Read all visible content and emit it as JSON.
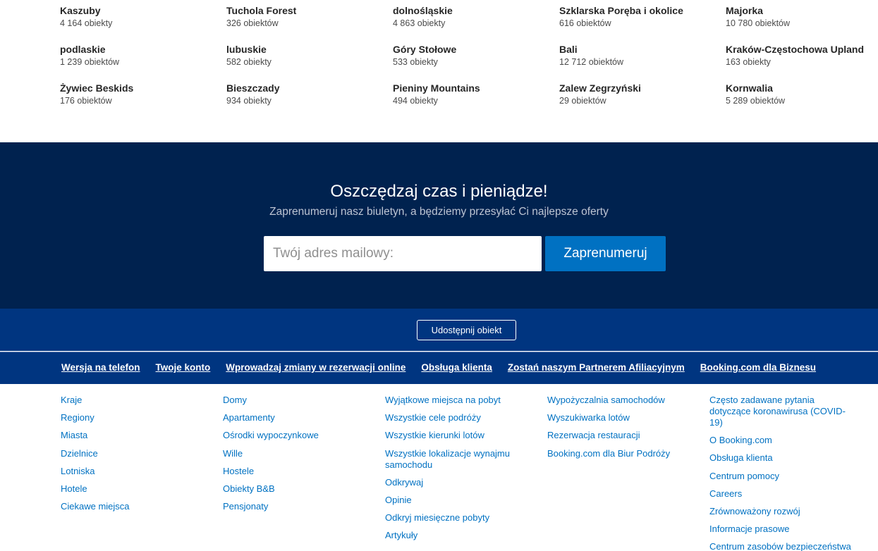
{
  "destinations": [
    {
      "name": "Kaszuby",
      "count": "4 164 obiekty"
    },
    {
      "name": "Tuchola Forest",
      "count": "326 obiektów"
    },
    {
      "name": "dolnośląskie",
      "count": "4 863 obiekty"
    },
    {
      "name": "Szklarska Poręba i okolice",
      "count": "616 obiektów"
    },
    {
      "name": "Majorka",
      "count": "10 780 obiektów"
    },
    {
      "name": "podlaskie",
      "count": "1 239 obiektów"
    },
    {
      "name": "lubuskie",
      "count": "582 obiekty"
    },
    {
      "name": "Góry Stołowe",
      "count": "533 obiekty"
    },
    {
      "name": "Bali",
      "count": "12 712 obiektów"
    },
    {
      "name": "Kraków-Częstochowa Upland",
      "count": "163 obiekty"
    },
    {
      "name": "Żywiec Beskids",
      "count": "176 obiektów"
    },
    {
      "name": "Bieszczady",
      "count": "934 obiekty"
    },
    {
      "name": "Pieniny Mountains",
      "count": "494 obiekty"
    },
    {
      "name": "Zalew Zegrzyński",
      "count": "29 obiektów"
    },
    {
      "name": "Kornwalia",
      "count": "5 289 obiektów"
    }
  ],
  "newsletter": {
    "title": "Oszczędzaj czas i pieniądze!",
    "subtitle": "Zaprenumeruj nasz biuletyn, a będziemy przesyłać Ci najlepsze oferty",
    "email_placeholder": "Twój adres mailowy:",
    "subscribe_label": "Zaprenumeruj"
  },
  "list_property": {
    "button_label": "Udostępnij obiekt"
  },
  "footer_bar": {
    "links": [
      "Wersja na telefon",
      "Twoje konto",
      "Wprowadzaj zmiany w rezerwacji online",
      "Obsługa klienta",
      "Zostań naszym Partnerem Afiliacyjnym",
      "Booking.com dla Biznesu"
    ]
  },
  "footer_columns": [
    [
      "Kraje",
      "Regiony",
      "Miasta",
      "Dzielnice",
      "Lotniska",
      "Hotele",
      "Ciekawe miejsca"
    ],
    [
      "Domy",
      "Apartamenty",
      "Ośrodki wypoczynkowe",
      "Wille",
      "Hostele",
      "Obiekty B&B",
      "Pensjonaty"
    ],
    [
      "Wyjątkowe miejsca na pobyt",
      "Wszystkie cele podróży",
      "Wszystkie kierunki lotów",
      "Wszystkie lokalizacje wynajmu samochodu",
      "Odkrywaj",
      "Opinie",
      "Odkryj miesięczne pobyty",
      "Artykuły"
    ],
    [
      "Wypożyczalnia samochodów",
      "Wyszukiwarka lotów",
      "Rezerwacja restauracji",
      "Booking.com dla Biur Podróży"
    ],
    [
      "Często zadawane pytania dotyczące koronawirusa (COVID-19)",
      "O Booking.com",
      "Obsługa klienta",
      "Centrum pomocy",
      "Careers",
      "Zrównoważony rozwój",
      "Informacje prasowe",
      "Centrum zasobów bezpieczeństwa"
    ]
  ],
  "colors": {
    "newsletter_bg": "#00224f",
    "brand_blue": "#003580",
    "button_blue": "#0071c2",
    "link_blue": "#0071c2"
  }
}
